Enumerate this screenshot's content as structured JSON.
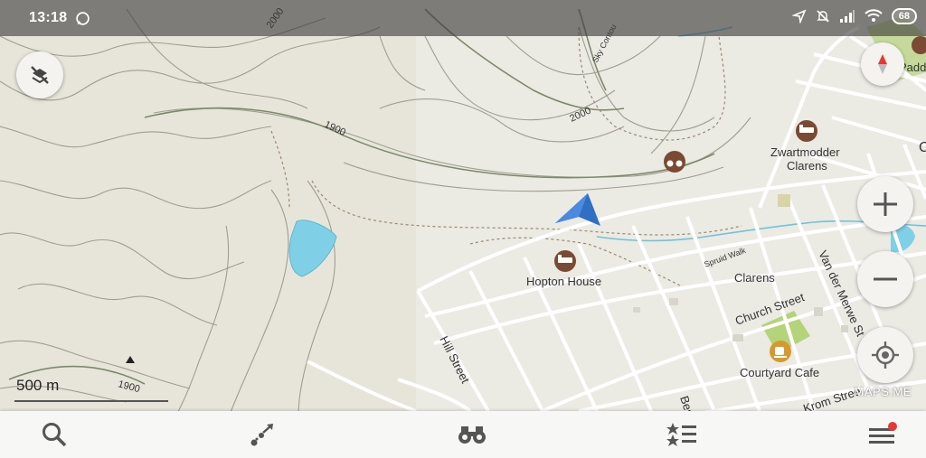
{
  "status_bar": {
    "time": "13:18",
    "battery": "68"
  },
  "map": {
    "scale_label": "500 m",
    "watermark": "MAPS.ME",
    "streets": {
      "hill_street": "Hill Street",
      "church_street": "Church Street",
      "van_der_merwe": "Van der Merwe St",
      "bester_street": "Bester Stree",
      "krom_street": "Krom Stree",
      "spruit_walk": "Spruid Walk",
      "sky_contour": "Sky Contou"
    },
    "contours": {
      "c1": "2000",
      "c2": "2000",
      "c3": "1900",
      "c4": "1900"
    },
    "places": {
      "paddock": "Paddo",
      "hopton_house": "Hopton House",
      "zwartmodder_line1": "Zwartmodder",
      "zwartmodder_line2": "Clarens",
      "clarens": "Clarens",
      "courtyard_cafe": "Courtyard Cafe",
      "edge_letter": "C"
    }
  },
  "bottom_nav": {
    "items": [
      {
        "name": "search",
        "icon": "search-icon"
      },
      {
        "name": "route",
        "icon": "route-icon"
      },
      {
        "name": "discovery",
        "icon": "binoculars-icon"
      },
      {
        "name": "bookmarks",
        "icon": "bookmarks-icon"
      },
      {
        "name": "menu",
        "icon": "menu-icon"
      }
    ]
  },
  "colors": {
    "water": "#7fd0e6",
    "park": "#b5d37a",
    "poi": "#7a4a32",
    "accent": "#e53935",
    "arrow": "#2f6fc4"
  }
}
